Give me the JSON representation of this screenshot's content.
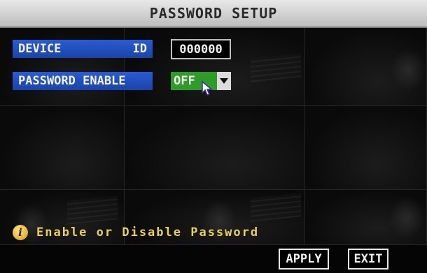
{
  "title": "PASSWORD SETUP",
  "device_id": {
    "label_left": "DEVICE",
    "label_right": "ID",
    "value": "000000"
  },
  "password_enable": {
    "label": "PASSWORD ENABLE",
    "selected": "OFF"
  },
  "hint": {
    "icon": "info-icon",
    "text": "Enable or Disable Password"
  },
  "buttons": {
    "apply": "APPLY",
    "exit": "EXIT"
  },
  "colors": {
    "label_bg": "#2a5bd3",
    "select_bg": "#2f9c2a",
    "hint_text": "#e8d05a"
  }
}
